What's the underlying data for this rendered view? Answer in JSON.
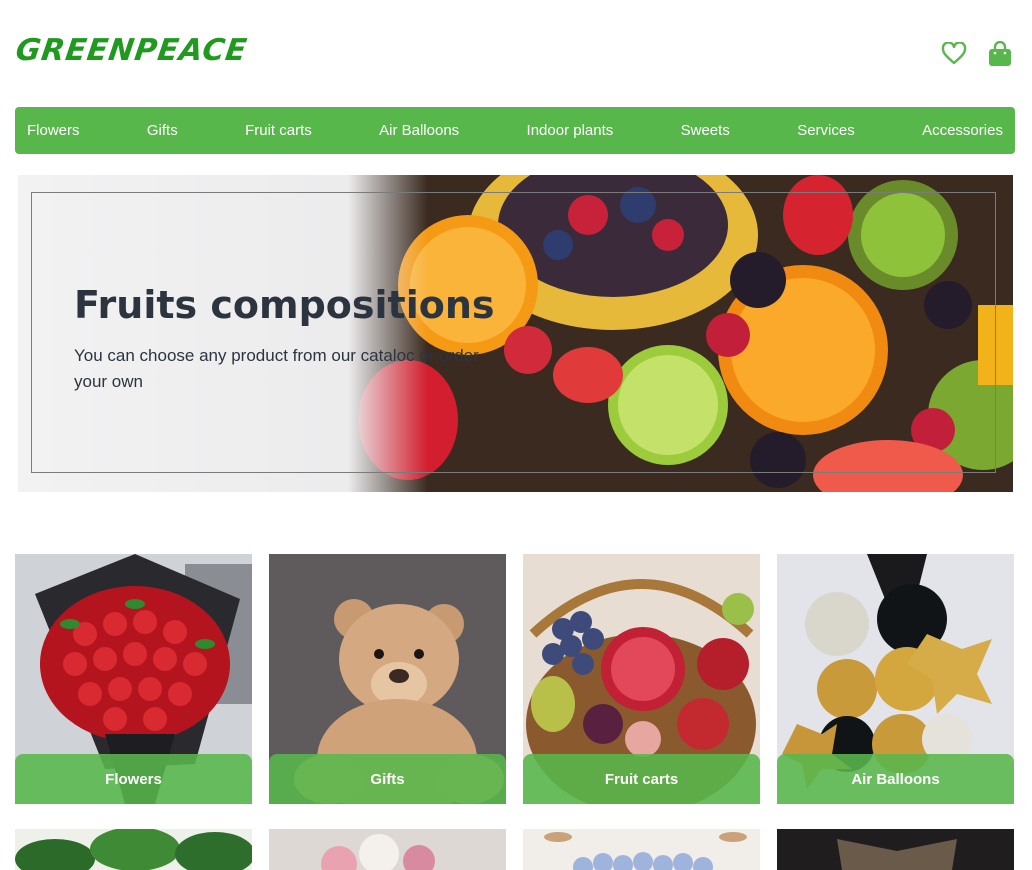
{
  "header": {
    "logo": "GREENPEACE",
    "icons": [
      "heart-icon",
      "shopping-bag-icon"
    ]
  },
  "nav": {
    "items": [
      "Flowers",
      "Gifts",
      "Fruit carts",
      "Air Balloons",
      "Indoor plants",
      "Sweets",
      "Services",
      "Accessories"
    ]
  },
  "hero": {
    "title": "Fruits compositions",
    "subtitle": "You can choose any product from our cataloc or order your own"
  },
  "categories": [
    {
      "label": "Flowers"
    },
    {
      "label": "Gifts"
    },
    {
      "label": "Fruit carts"
    },
    {
      "label": "Air Balloons"
    }
  ],
  "colors": {
    "brand_green": "#58b74b",
    "logo_green": "#1f9a1f",
    "text_dark": "#2c3440"
  }
}
